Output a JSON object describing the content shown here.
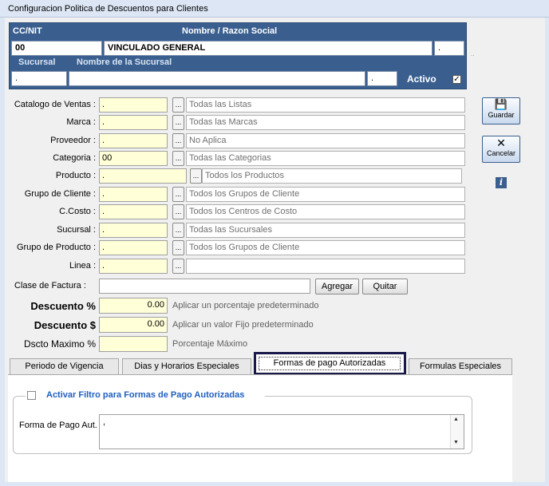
{
  "window": {
    "title": "Configuracion Politica de Descuentos para Clientes"
  },
  "header": {
    "cc_label": "CC/NIT",
    "nombre_label": "Nombre / Razon Social",
    "cc_value": "00",
    "nombre_value": "VINCULADO GENERAL",
    "extra_value": ".",
    "sucursal_label": "Sucursal",
    "nombre_sucursal_label": "Nombre de la Sucursal",
    "sucursal_value": ".",
    "nombre_sucursal_value": "",
    "suc_extra_value": ".",
    "activo_label": "Activo",
    "activo_checked": true
  },
  "fields": [
    {
      "label": "Catalogo de Ventas :",
      "value": ".",
      "desc": "Todas las Listas"
    },
    {
      "label": "Marca :",
      "value": ".",
      "desc": "Todas las Marcas"
    },
    {
      "label": "Proveedor :",
      "value": ".",
      "desc": "No Aplica"
    },
    {
      "label": "Categoria :",
      "value": "00",
      "desc": "Todas las Categorias"
    },
    {
      "label": "Producto :",
      "value": ".",
      "desc": "Todos los Productos"
    },
    {
      "label": "Grupo de Cliente :",
      "value": ".",
      "desc": "Todos los Grupos de Cliente"
    },
    {
      "label": "C.Costo :",
      "value": ".",
      "desc": "Todos los Centros de Costo"
    },
    {
      "label": "Sucursal :",
      "value": ".",
      "desc": "Todas las Sucursales"
    },
    {
      "label": "Grupo de Producto :",
      "value": ".",
      "desc": "Todos los Grupos de Cliente"
    },
    {
      "label": "Linea :",
      "value": ".",
      "desc": ""
    }
  ],
  "dots_label": "...",
  "clase": {
    "label": "Clase de Factura :",
    "value": "",
    "agregar": "Agregar",
    "quitar": "Quitar"
  },
  "descuentos": [
    {
      "label": "Descuento %",
      "value": "0.00",
      "note": "Aplicar un porcentaje predeterminado"
    },
    {
      "label": "Descuento $",
      "value": "0.00",
      "note": "Aplicar un valor Fijo predeterminado"
    },
    {
      "label": "Dscto Maximo %",
      "value": "",
      "note": "Porcentaje Máximo"
    }
  ],
  "tabs": [
    "Periodo de  Vigencia",
    "Dias y Horarios Especiales",
    "Formas de pago Autorizadas",
    "Formulas Especiales"
  ],
  "filtro": {
    "label": "Activar Filtro para Formas de Pago Autorizadas",
    "checked": false,
    "forma_label": "Forma de Pago Aut.",
    "forma_value": ","
  },
  "side": {
    "guardar": "Guardar",
    "cancelar": "Cancelar",
    "info": "i"
  },
  "colors": {
    "header_blue": "#3a5f8f",
    "field_yellow": "#ffffd8",
    "link_blue": "#1f5fbf"
  }
}
